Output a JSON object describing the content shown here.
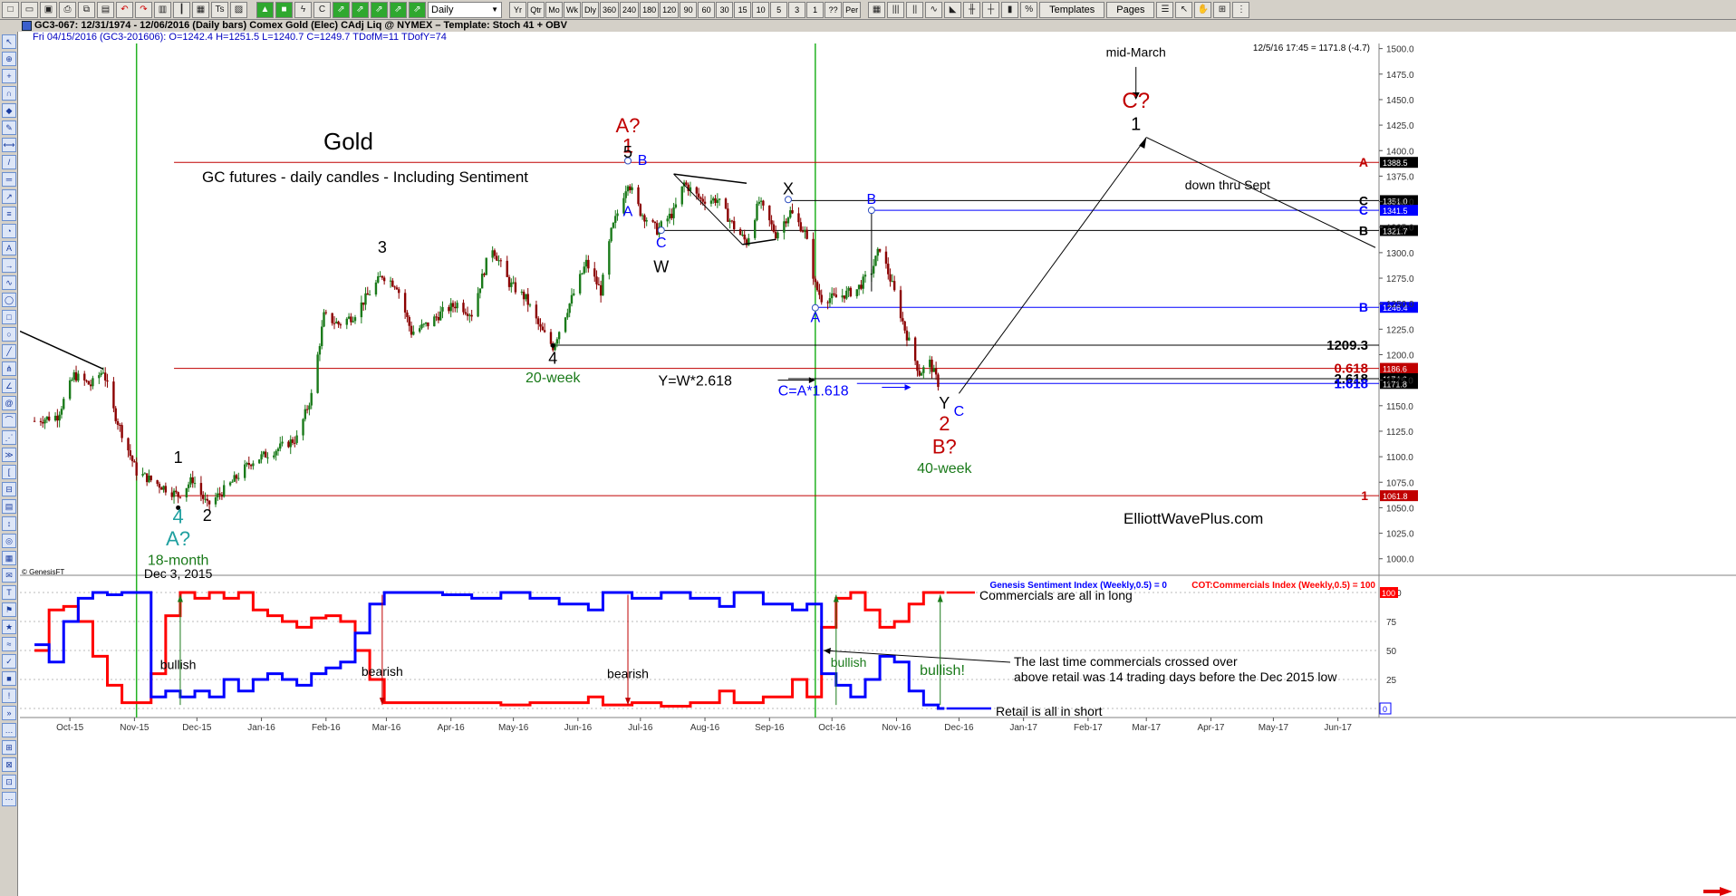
{
  "toolbar": {
    "left_icons": [
      "new-icon",
      "open-icon",
      "save-icon",
      "print-icon",
      "copy-icon",
      "paste-icon",
      "undo-icon",
      "redo-icon",
      "chart-icon",
      "bars-icon",
      "grid-icon",
      "text-tool-icon",
      "layout-icon"
    ],
    "period_select": "Daily",
    "periods": [
      "Yr",
      "Qtr",
      "Mo",
      "Wk",
      "Dly",
      "360",
      "240",
      "180",
      "120",
      "90",
      "60",
      "30",
      "15",
      "10",
      "5",
      "3",
      "1",
      "??",
      "Per"
    ],
    "templates_label": "Templates",
    "pages_label": "Pages"
  },
  "titlebar": {
    "text": "GC3-067:  12/31/1974 - 12/06/2016  (Daily bars)   Comex Gold (Elec) CAdj Liq @ NYMEX  –  Template: Stoch 41 + OBV"
  },
  "infobar": {
    "text": "Fri   04/15/2016 (GC3-201606):  O=1242.4   H=1251.5   L=1240.7   C=1249.7   TDofM=11   TDofY=74"
  },
  "sidebar": {
    "tools": [
      "cursor",
      "zoom",
      "crosshair",
      "magnet",
      "eraser",
      "pencil",
      "measure",
      "line",
      "channel",
      "ray",
      "fib",
      "gann",
      "text",
      "arrow",
      "elliott",
      "cycle",
      "box",
      "circle",
      "trend",
      "pitch",
      "angle",
      "spiral",
      "arc",
      "fan",
      "speed",
      "bracket",
      "time",
      "zone",
      "range",
      "target",
      "grid",
      "note",
      "label",
      "flag",
      "star",
      "wave",
      "mark",
      "stop",
      "alert",
      "more",
      "extra",
      "tool42",
      "tool43",
      "tool44",
      "tool45"
    ]
  },
  "colors": {
    "up": "#1a7a1a",
    "down": "#8b0000",
    "retail": "#0000ff",
    "commercials": "#ff0000",
    "vline": "#22b222",
    "accent": "#c00000"
  },
  "chart_data": {
    "type": "candlestick",
    "title": "Gold",
    "subtitle": "GC futures - daily candles - Including Sentiment",
    "header_readout": "12/5/16 17:45 = 1171.8 (-4.7)",
    "copyright": "© GenesisFT",
    "watermark": "ElliottWavePlus.com",
    "x_labels": [
      "Oct-15",
      "Nov-15",
      "Dec-15",
      "Jan-16",
      "Feb-16",
      "Mar-16",
      "Apr-16",
      "May-16",
      "Jun-16",
      "Jul-16",
      "Aug-16",
      "Sep-16",
      "Oct-16",
      "Nov-16",
      "Dec-16",
      "Jan-17",
      "Feb-17",
      "Mar-17",
      "Apr-17",
      "May-17",
      "Jun-17"
    ],
    "y_ticks": [
      1000,
      1025,
      1050,
      1075,
      1100,
      1125,
      1150,
      1175,
      1200,
      1225,
      1250,
      1275,
      1300,
      1325,
      1350,
      1375,
      1400,
      1425,
      1450,
      1475,
      1500
    ],
    "ylim": [
      990,
      1505
    ],
    "path": [
      [
        "2015-09-25",
        1135
      ],
      [
        "2015-10-06",
        1140
      ],
      [
        "2015-10-14",
        1180
      ],
      [
        "2015-10-22",
        1170
      ],
      [
        "2015-10-28",
        1185
      ],
      [
        "2015-11-02",
        1145
      ],
      [
        "2015-11-13",
        1085
      ],
      [
        "2015-11-20",
        1077
      ],
      [
        "2015-12-03",
        1062
      ],
      [
        "2015-12-10",
        1078
      ],
      [
        "2015-12-17",
        1052
      ],
      [
        "2015-12-28",
        1073
      ],
      [
        "2016-01-07",
        1095
      ],
      [
        "2016-01-20",
        1108
      ],
      [
        "2016-01-29",
        1118
      ],
      [
        "2016-02-05",
        1160
      ],
      [
        "2016-02-11",
        1238
      ],
      [
        "2016-02-18",
        1230
      ],
      [
        "2016-02-25",
        1238
      ],
      [
        "2016-03-03",
        1258
      ],
      [
        "2016-03-10",
        1278
      ],
      [
        "2016-03-17",
        1268
      ],
      [
        "2016-03-24",
        1222
      ],
      [
        "2016-04-01",
        1230
      ],
      [
        "2016-04-08",
        1242
      ],
      [
        "2016-04-15",
        1250
      ],
      [
        "2016-04-22",
        1240
      ],
      [
        "2016-04-29",
        1290
      ],
      [
        "2016-05-02",
        1305
      ],
      [
        "2016-05-10",
        1270
      ],
      [
        "2016-05-18",
        1255
      ],
      [
        "2016-05-25",
        1225
      ],
      [
        "2016-05-31",
        1208
      ],
      [
        "2016-06-07",
        1245
      ],
      [
        "2016-06-16",
        1290
      ],
      [
        "2016-06-23",
        1262
      ],
      [
        "2016-06-28",
        1320
      ],
      [
        "2016-07-06",
        1370
      ],
      [
        "2016-07-12",
        1340
      ],
      [
        "2016-07-20",
        1322
      ],
      [
        "2016-07-28",
        1340
      ],
      [
        "2016-08-02",
        1368
      ],
      [
        "2016-08-10",
        1352
      ],
      [
        "2016-08-18",
        1352
      ],
      [
        "2016-08-26",
        1325
      ],
      [
        "2016-09-01",
        1310
      ],
      [
        "2016-09-07",
        1350
      ],
      [
        "2016-09-15",
        1318
      ],
      [
        "2016-09-22",
        1340
      ],
      [
        "2016-09-29",
        1320
      ],
      [
        "2016-10-04",
        1268
      ],
      [
        "2016-10-07",
        1255
      ],
      [
        "2016-10-14",
        1256
      ],
      [
        "2016-10-24",
        1264
      ],
      [
        "2016-10-31",
        1282
      ],
      [
        "2016-11-04",
        1305
      ],
      [
        "2016-11-10",
        1268
      ],
      [
        "2016-11-16",
        1225
      ],
      [
        "2016-11-23",
        1182
      ],
      [
        "2016-11-28",
        1192
      ],
      [
        "2016-12-02",
        1172
      ],
      [
        "2016-12-05",
        1171
      ]
    ],
    "levels": [
      {
        "value": 1388.5,
        "color": "#c00000",
        "start": "2015-12-01",
        "tag": "1388.5",
        "tagbg": "#000000",
        "right_label": "A"
      },
      {
        "value": 1351.0,
        "color": "#000000",
        "start": "2016-09-21",
        "tag": "1351.0",
        "tagbg": "#000000",
        "right_label": "C"
      },
      {
        "value": 1341.5,
        "color": "#0000ff",
        "start": "2016-10-31",
        "tag": "1341.5",
        "tagbg": "#0000ff",
        "right_label": "C"
      },
      {
        "value": 1321.7,
        "color": "#000000",
        "start": "2016-07-22",
        "tag": "1321.7",
        "tagbg": "#000000",
        "right_label": "B"
      },
      {
        "value": 1246.4,
        "color": "#0000ff",
        "start": "2016-10-04",
        "tag": "1246.4",
        "tagbg": "#0000ff",
        "right_label": "B"
      },
      {
        "value": 1209.3,
        "color": "#000000",
        "start": "2016-06-01",
        "right_label": "1209.3"
      },
      {
        "value": 1186.6,
        "color": "#c00000",
        "start": "2015-12-01",
        "tag": "1186.6",
        "tagbg": "#c00000",
        "right_label": "0.618"
      },
      {
        "value": 1176.5,
        "color": "#000000",
        "start": "2016-09-21",
        "tag": "1174.6",
        "tagbg": "#000000",
        "right_label": "2.618"
      },
      {
        "value": 1171.8,
        "color": "#0000ff",
        "start": "2016-10-24",
        "tag": "1171.8",
        "tagbg": "#000000",
        "right_label": "1.618"
      },
      {
        "value": 1061.8,
        "color": "#c00000",
        "start": "2015-12-01",
        "tag": "1061.8",
        "tagbg": "#c00000",
        "right_label": "1"
      }
    ],
    "vlines": [
      "2015-11-13",
      "2016-10-04"
    ],
    "wave_labels": [
      {
        "text": "A?",
        "date": "2016-07-06",
        "price": 1418,
        "color": "#c00000",
        "size": 22
      },
      {
        "text": "1",
        "date": "2016-07-06",
        "price": 1398,
        "color": "#c00000",
        "size": 22
      },
      {
        "text": "5",
        "date": "2016-07-06",
        "price": 1393,
        "color": "#000000",
        "size": 18
      },
      {
        "text": "B",
        "date": "2016-07-13",
        "price": 1386,
        "color": "#0000ff",
        "size": 16
      },
      {
        "text": "A",
        "date": "2016-07-06",
        "price": 1336,
        "color": "#0000ff",
        "size": 16
      },
      {
        "text": "C",
        "date": "2016-07-22",
        "price": 1305,
        "color": "#0000ff",
        "size": 16
      },
      {
        "text": "W",
        "date": "2016-07-22",
        "price": 1281,
        "color": "#000000",
        "size": 18
      },
      {
        "text": "X",
        "date": "2016-09-21",
        "price": 1357,
        "color": "#000000",
        "size": 18
      },
      {
        "text": "B",
        "date": "2016-10-31",
        "price": 1348,
        "color": "#0000ff",
        "size": 16
      },
      {
        "text": "A",
        "date": "2016-10-04",
        "price": 1232,
        "color": "#0000ff",
        "size": 16
      },
      {
        "text": "3",
        "date": "2016-03-10",
        "price": 1300,
        "color": "#000000",
        "size": 18
      },
      {
        "text": "4",
        "date": "2016-05-31",
        "price": 1191,
        "color": "#000000",
        "size": 18
      },
      {
        "text": "20-week",
        "date": "2016-05-31",
        "price": 1173,
        "color": "#1a7a1a",
        "size": 16
      },
      {
        "text": "1",
        "date": "2015-12-03",
        "price": 1094,
        "color": "#000000",
        "size": 18
      },
      {
        "text": "2",
        "date": "2015-12-17",
        "price": 1037,
        "color": "#000000",
        "size": 18
      },
      {
        "text": "4",
        "date": "2015-12-03",
        "price": 1035,
        "color": "#20a0a0",
        "size": 22
      },
      {
        "text": "A?",
        "date": "2015-12-03",
        "price": 1013,
        "color": "#20a0a0",
        "size": 22
      },
      {
        "text": "18-month",
        "date": "2015-12-03",
        "price": 994,
        "color": "#1a7a1a",
        "size": 16
      },
      {
        "text": "Dec 3, 2015",
        "date": "2015-12-03",
        "price": 981,
        "color": "#000000",
        "size": 14
      },
      {
        "text": "Y",
        "date": "2016-12-05",
        "price": 1147,
        "color": "#000000",
        "size": 18
      },
      {
        "text": "C",
        "date": "2016-12-12",
        "price": 1140,
        "color": "#0000ff",
        "size": 16
      },
      {
        "text": "2",
        "date": "2016-12-05",
        "price": 1126,
        "color": "#c00000",
        "size": 22
      },
      {
        "text": "B?",
        "date": "2016-12-05",
        "price": 1103,
        "color": "#c00000",
        "size": 22
      },
      {
        "text": "40-week",
        "date": "2016-12-05",
        "price": 1084,
        "color": "#1a7a1a",
        "size": 16
      },
      {
        "text": "C?",
        "date": "2017-03-07",
        "price": 1442,
        "color": "#c00000",
        "size": 24
      },
      {
        "text": "1",
        "date": "2017-03-07",
        "price": 1420,
        "color": "#000000",
        "size": 20
      },
      {
        "text": "mid-March",
        "date": "2017-03-07",
        "price": 1492,
        "color": "#000000",
        "size": 14
      },
      {
        "text": "down thru Sept",
        "date": "2017-04-20",
        "price": 1362,
        "color": "#000000",
        "size": 14
      }
    ],
    "equations": [
      {
        "text": "Y=W*2.618",
        "date": "2016-08-25",
        "price": 1170,
        "color": "#000000"
      },
      {
        "text": "C=A*1.618",
        "date": "2016-10-20",
        "price": 1160,
        "color": "#0000ff"
      }
    ],
    "sentiment": {
      "legend_blue": "Genesis Sentiment Index (Weekly,0.5) = 0",
      "legend_red": "COT:Commercials Index (Weekly,0.5) = 100",
      "y_ticks": [
        0,
        25,
        50,
        75,
        100
      ],
      "commercials_label": "Commercials are all in long",
      "retail_label": "Retail is all in short",
      "note_line1": "The last time commercials crossed over",
      "note_line2": "above retail was 14 trading days before the Dec 2015 low",
      "annotations": [
        {
          "text": "bullish",
          "date": "2015-12-03",
          "value": 38,
          "color": "#000000"
        },
        {
          "text": "bearish",
          "date": "2016-03-10",
          "value": 32,
          "color": "#000000"
        },
        {
          "text": "bearish",
          "date": "2016-07-06",
          "value": 30,
          "color": "#000000"
        },
        {
          "text": "bullish",
          "date": "2016-10-20",
          "value": 40,
          "color": "#1a7a1a"
        },
        {
          "text": "bullish!",
          "date": "2016-12-04",
          "value": 33,
          "color": "#1a7a1a"
        }
      ],
      "commercials": [
        [
          "2015-09-25",
          50
        ],
        [
          "2015-10-02",
          85
        ],
        [
          "2015-10-09",
          88
        ],
        [
          "2015-10-16",
          75
        ],
        [
          "2015-10-23",
          45
        ],
        [
          "2015-10-30",
          20
        ],
        [
          "2015-11-06",
          5
        ],
        [
          "2015-11-13",
          5
        ],
        [
          "2015-11-20",
          30
        ],
        [
          "2015-11-27",
          80
        ],
        [
          "2015-12-04",
          100
        ],
        [
          "2015-12-11",
          95
        ],
        [
          "2015-12-18",
          100
        ],
        [
          "2015-12-25",
          95
        ],
        [
          "2016-01-01",
          100
        ],
        [
          "2016-01-08",
          85
        ],
        [
          "2016-01-15",
          80
        ],
        [
          "2016-01-22",
          75
        ],
        [
          "2016-01-29",
          70
        ],
        [
          "2016-02-05",
          78
        ],
        [
          "2016-02-12",
          80
        ],
        [
          "2016-02-19",
          75
        ],
        [
          "2016-02-26",
          50
        ],
        [
          "2016-03-04",
          25
        ],
        [
          "2016-03-11",
          5
        ],
        [
          "2016-03-18",
          5
        ],
        [
          "2016-03-25",
          5
        ],
        [
          "2016-04-08",
          5
        ],
        [
          "2016-04-22",
          5
        ],
        [
          "2016-05-06",
          3
        ],
        [
          "2016-05-20",
          5
        ],
        [
          "2016-06-03",
          5
        ],
        [
          "2016-06-17",
          10
        ],
        [
          "2016-06-24",
          3
        ],
        [
          "2016-07-08",
          5
        ],
        [
          "2016-07-22",
          2
        ],
        [
          "2016-08-05",
          5
        ],
        [
          "2016-08-19",
          15
        ],
        [
          "2016-08-26",
          5
        ],
        [
          "2016-09-09",
          10
        ],
        [
          "2016-09-23",
          25
        ],
        [
          "2016-09-30",
          10
        ],
        [
          "2016-10-07",
          70
        ],
        [
          "2016-10-14",
          95
        ],
        [
          "2016-10-21",
          100
        ],
        [
          "2016-10-28",
          85
        ],
        [
          "2016-11-04",
          70
        ],
        [
          "2016-11-11",
          75
        ],
        [
          "2016-11-18",
          90
        ],
        [
          "2016-11-25",
          100
        ],
        [
          "2016-12-02",
          100
        ],
        [
          "2016-12-05",
          100
        ]
      ],
      "retail": [
        [
          "2015-09-25",
          55
        ],
        [
          "2015-10-02",
          40
        ],
        [
          "2015-10-09",
          75
        ],
        [
          "2015-10-16",
          95
        ],
        [
          "2015-10-23",
          100
        ],
        [
          "2015-10-30",
          98
        ],
        [
          "2015-11-06",
          100
        ],
        [
          "2015-11-13",
          100
        ],
        [
          "2015-11-20",
          10
        ],
        [
          "2015-11-27",
          15
        ],
        [
          "2015-12-04",
          10
        ],
        [
          "2015-12-11",
          15
        ],
        [
          "2015-12-18",
          10
        ],
        [
          "2015-12-25",
          25
        ],
        [
          "2016-01-01",
          15
        ],
        [
          "2016-01-08",
          25
        ],
        [
          "2016-01-15",
          30
        ],
        [
          "2016-01-22",
          25
        ],
        [
          "2016-01-29",
          20
        ],
        [
          "2016-02-05",
          30
        ],
        [
          "2016-02-12",
          35
        ],
        [
          "2016-02-19",
          40
        ],
        [
          "2016-02-26",
          65
        ],
        [
          "2016-03-04",
          90
        ],
        [
          "2016-03-11",
          100
        ],
        [
          "2016-03-25",
          100
        ],
        [
          "2016-04-08",
          98
        ],
        [
          "2016-04-22",
          95
        ],
        [
          "2016-05-06",
          100
        ],
        [
          "2016-05-20",
          95
        ],
        [
          "2016-06-03",
          90
        ],
        [
          "2016-06-17",
          85
        ],
        [
          "2016-06-24",
          100
        ],
        [
          "2016-07-08",
          95
        ],
        [
          "2016-07-22",
          100
        ],
        [
          "2016-08-05",
          95
        ],
        [
          "2016-08-19",
          88
        ],
        [
          "2016-08-26",
          100
        ],
        [
          "2016-09-09",
          90
        ],
        [
          "2016-09-23",
          85
        ],
        [
          "2016-09-30",
          90
        ],
        [
          "2016-10-07",
          30
        ],
        [
          "2016-10-14",
          20
        ],
        [
          "2016-10-21",
          10
        ],
        [
          "2016-10-28",
          25
        ],
        [
          "2016-11-04",
          45
        ],
        [
          "2016-11-11",
          40
        ],
        [
          "2016-11-18",
          15
        ],
        [
          "2016-11-25",
          3
        ],
        [
          "2016-12-02",
          0
        ],
        [
          "2016-12-05",
          0
        ]
      ]
    }
  }
}
